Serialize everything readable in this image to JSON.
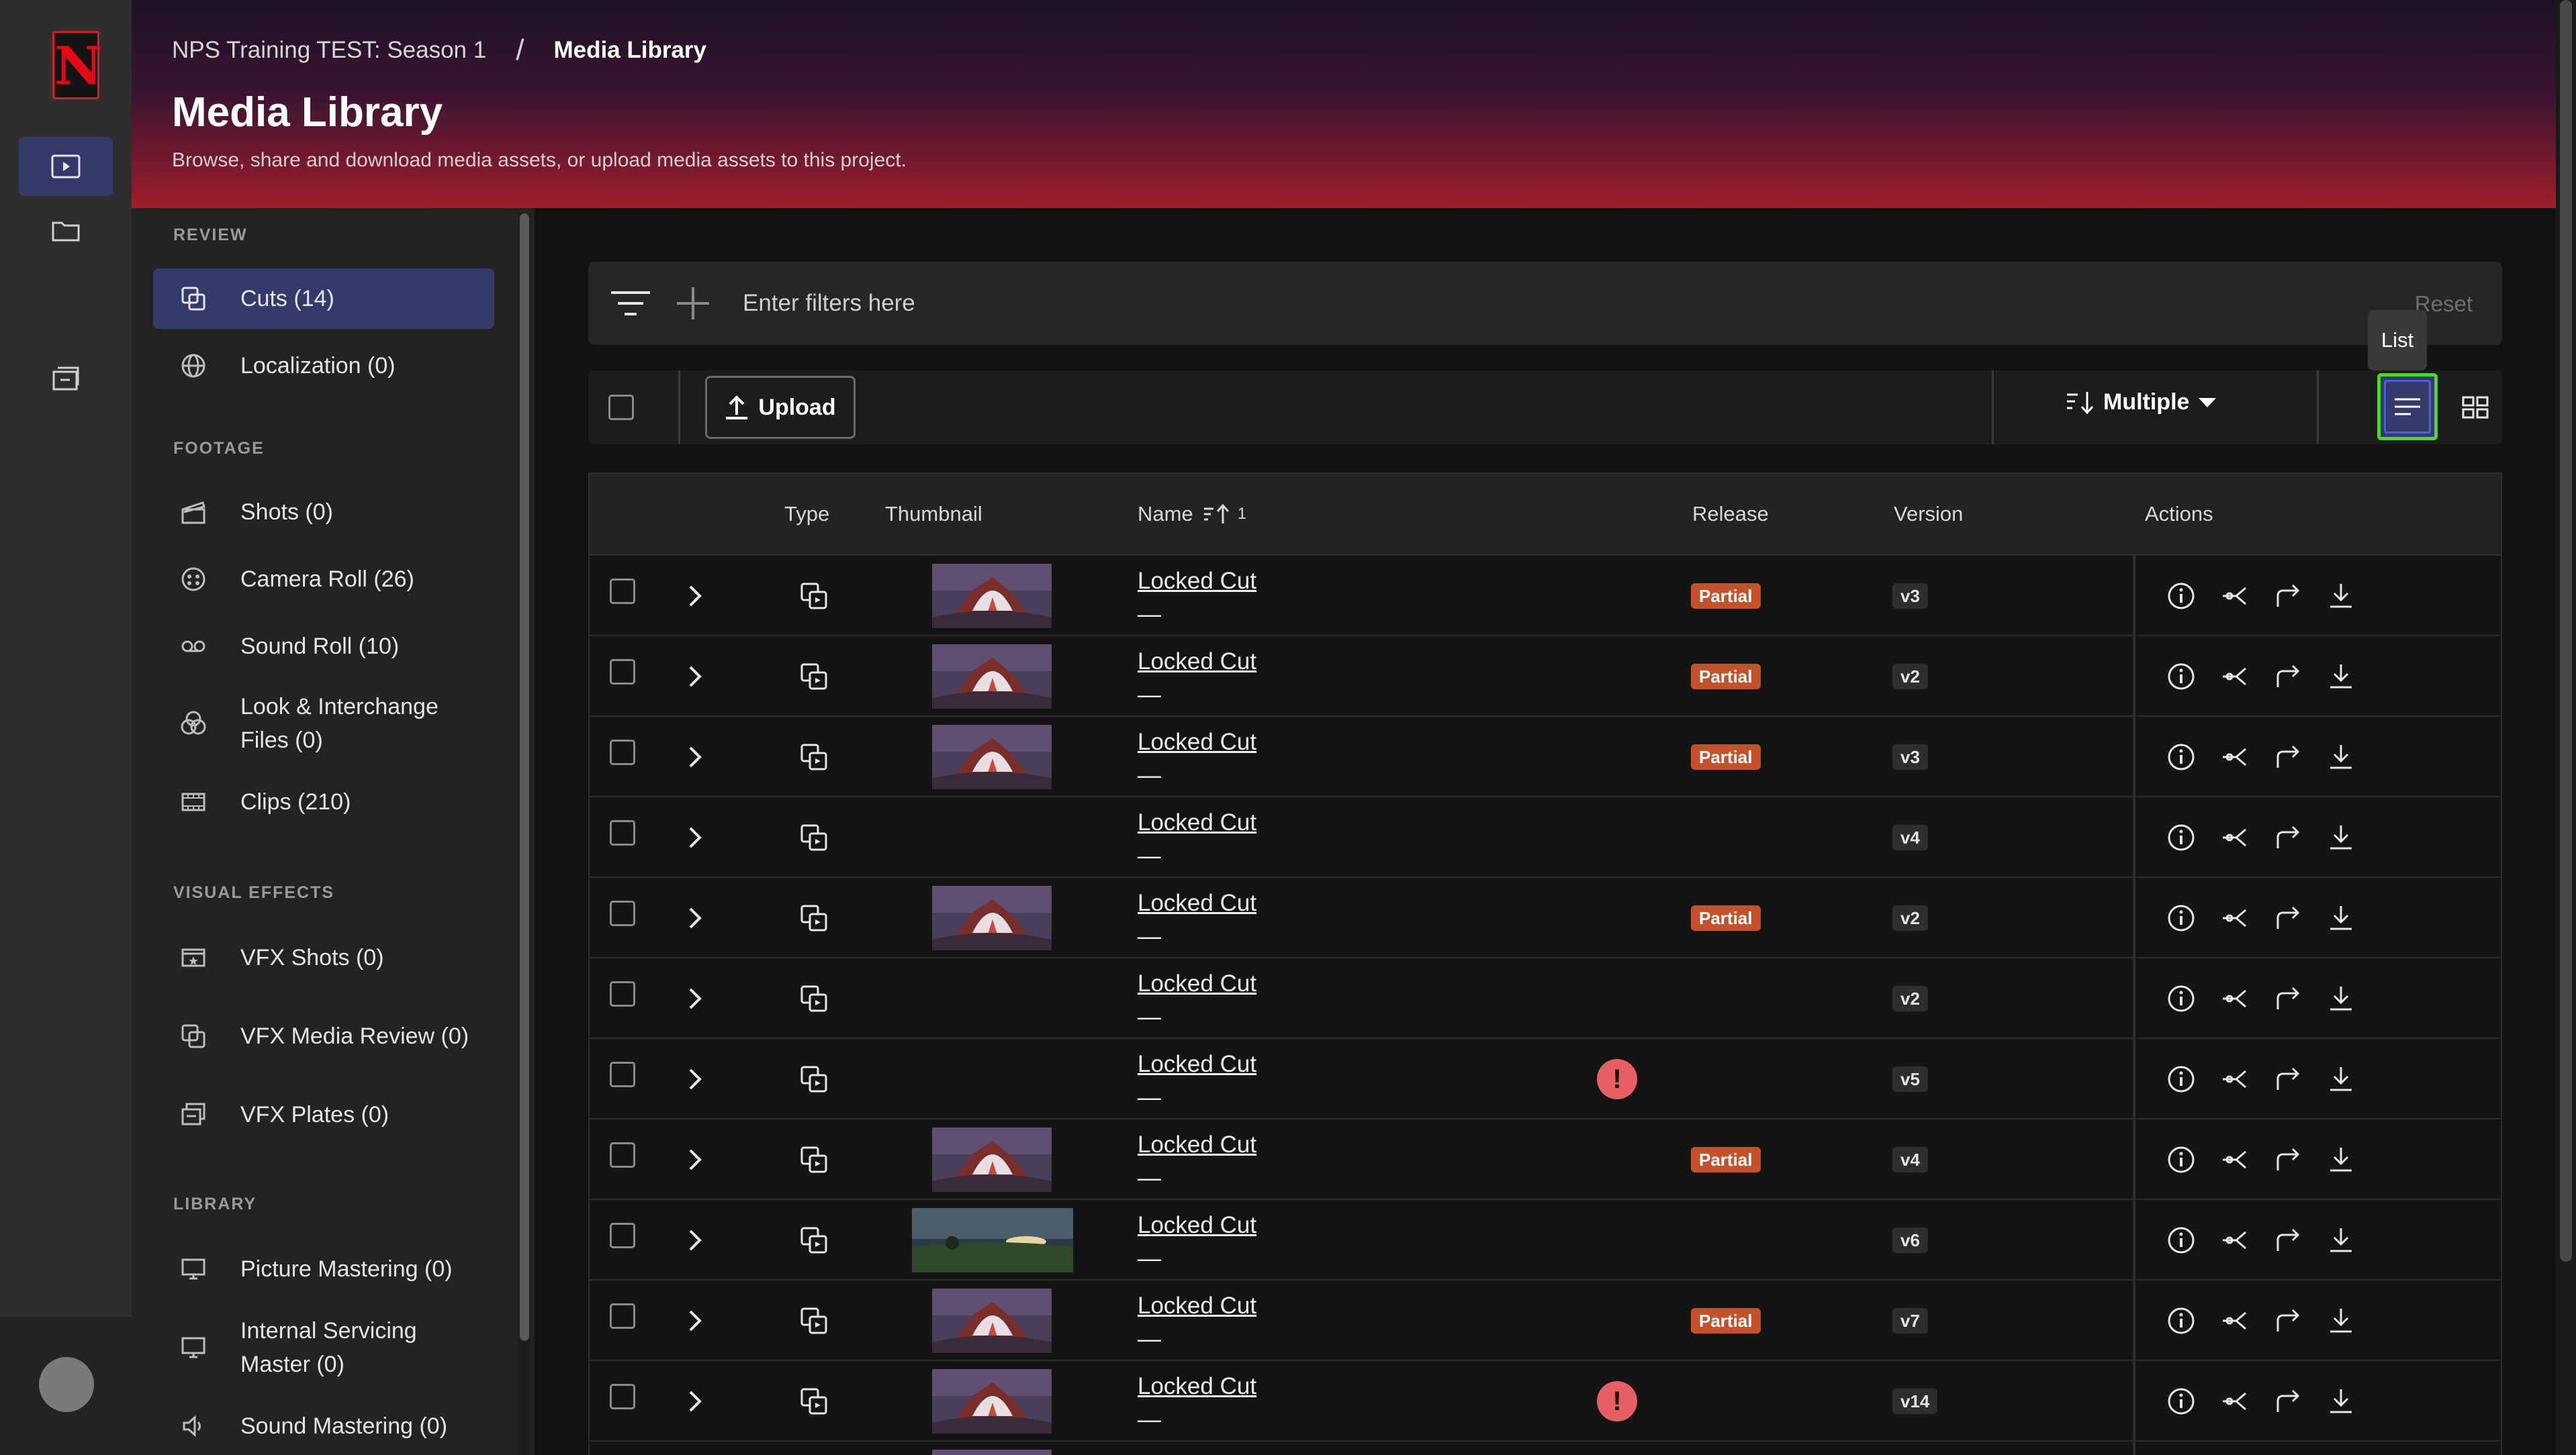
{
  "breadcrumb": {
    "project": "NPS Training TEST: Season 1",
    "separator": "/",
    "current": "Media Library"
  },
  "page": {
    "title": "Media Library",
    "subtitle": "Browse, share and download media assets, or upload media assets to this project."
  },
  "rail": {
    "logo_letter": "N"
  },
  "sidebar": {
    "sections": [
      {
        "title": "REVIEW",
        "items": [
          {
            "label": "Cuts (14)",
            "icon": "cuts-icon",
            "active": true
          },
          {
            "label": "Localization (0)",
            "icon": "globe-icon"
          }
        ]
      },
      {
        "title": "FOOTAGE",
        "items": [
          {
            "label": "Shots (0)",
            "icon": "clapper-icon"
          },
          {
            "label": "Camera Roll (26)",
            "icon": "film-reel-icon"
          },
          {
            "label": "Sound Roll (10)",
            "icon": "tape-icon"
          },
          {
            "label": "Look & Interchange Files (0)",
            "icon": "color-circles-icon"
          },
          {
            "label": "Clips (210)",
            "icon": "filmstrip-icon"
          }
        ]
      },
      {
        "title": "VISUAL EFFECTS",
        "items": [
          {
            "label": "VFX Shots (0)",
            "icon": "vfx-shots-icon"
          },
          {
            "label": "VFX Media Review (0)",
            "icon": "vfx-review-icon"
          },
          {
            "label": "VFX Plates (0)",
            "icon": "vfx-plates-icon"
          }
        ]
      },
      {
        "title": "LIBRARY",
        "items": [
          {
            "label": "Picture Mastering (0)",
            "icon": "monitor-icon"
          },
          {
            "label": "Internal Servicing Master (0)",
            "icon": "monitor-icon"
          },
          {
            "label": "Sound Mastering (0)",
            "icon": "speaker-icon"
          }
        ]
      }
    ]
  },
  "filters": {
    "placeholder": "Enter filters here",
    "reset": "Reset"
  },
  "toolbar": {
    "upload": "Upload",
    "sort": "Multiple",
    "tooltip": "List"
  },
  "table": {
    "columns": {
      "type": "Type",
      "thumbnail": "Thumbnail",
      "name": "Name",
      "sort_indicator": "1",
      "release": "Release",
      "version": "Version",
      "actions": "Actions"
    },
    "rows": [
      {
        "name": "Locked Cut",
        "sub": "—",
        "thumb": "fire",
        "release": "Partial",
        "version": "v3",
        "warning": false
      },
      {
        "name": "Locked Cut",
        "sub": "—",
        "thumb": "fire",
        "release": "Partial",
        "version": "v2",
        "warning": false
      },
      {
        "name": "Locked Cut",
        "sub": "—",
        "thumb": "fire",
        "release": "Partial",
        "version": "v3",
        "warning": false
      },
      {
        "name": "Locked Cut",
        "sub": "—",
        "thumb": "",
        "release": "",
        "version": "v4",
        "warning": false
      },
      {
        "name": "Locked Cut",
        "sub": "—",
        "thumb": "fire",
        "release": "Partial",
        "version": "v2",
        "warning": false
      },
      {
        "name": "Locked Cut",
        "sub": "—",
        "thumb": "",
        "release": "",
        "version": "v2",
        "warning": false
      },
      {
        "name": "Locked Cut",
        "sub": "—",
        "thumb": "",
        "release": "",
        "version": "v5",
        "warning": true
      },
      {
        "name": "Locked Cut",
        "sub": "—",
        "thumb": "fire",
        "release": "Partial",
        "version": "v4",
        "warning": false
      },
      {
        "name": "Locked Cut",
        "sub": "—",
        "thumb": "landscape",
        "release": "",
        "version": "v6",
        "warning": false
      },
      {
        "name": "Locked Cut",
        "sub": "—",
        "thumb": "fire",
        "release": "Partial",
        "version": "v7",
        "warning": false
      },
      {
        "name": "Locked Cut",
        "sub": "—",
        "thumb": "fire",
        "release": "",
        "version": "v14",
        "warning": true
      },
      {
        "name": "",
        "sub": "",
        "thumb": "fire",
        "release": "",
        "version": "",
        "warning": false
      }
    ],
    "warning_glyph": "!",
    "row_actions": [
      "info-icon",
      "share-icon",
      "forward-icon",
      "download-icon"
    ]
  },
  "colors": {
    "accent": "#343b6c",
    "focus": "#4cd92e",
    "partial": "#c5512a",
    "warning": "#e55f63",
    "brand": "#e50914"
  }
}
